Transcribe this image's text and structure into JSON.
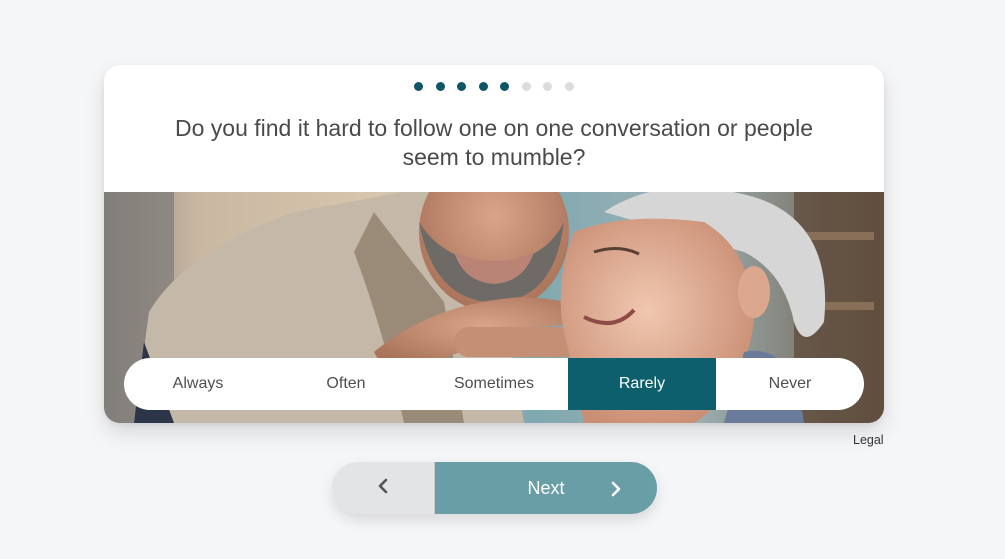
{
  "progress": {
    "total": 8,
    "completed": 5
  },
  "question": "Do you find it hard to follow one on one conversation or people seem to mumble?",
  "answers": {
    "items": [
      "Always",
      "Often",
      "Sometimes",
      "Rarely",
      "Never"
    ],
    "selected": "Rarely"
  },
  "legal_label": "Legal",
  "nav": {
    "back_icon": "chevron-left-icon",
    "next_label": "Next",
    "next_icon": "chevron-right-icon"
  },
  "colors": {
    "accent": "#0e5f6e",
    "dot_active": "#0e5566",
    "dot_inactive": "#dcdcdc",
    "next_button": "#6a9ea7",
    "back_button": "#e3e4e5",
    "background": "#f5f6f8"
  }
}
